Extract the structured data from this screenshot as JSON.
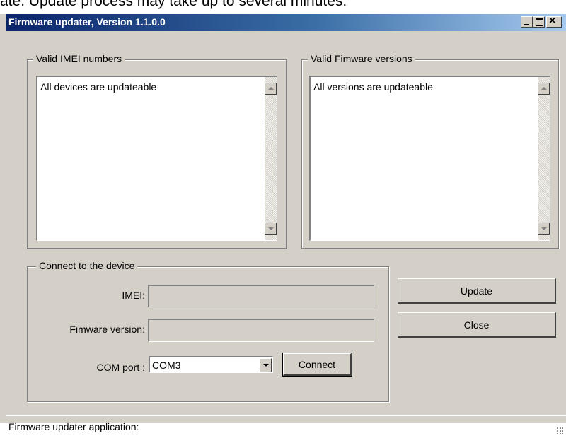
{
  "background_doc": {
    "text": "ate. Update process may take up to several minutes."
  },
  "window": {
    "title": "Firmware updater, Version 1.1.0.0",
    "controls": {
      "minimize_icon": "minimize-icon",
      "maximize_icon": "maximize-icon",
      "close_icon": "close-icon"
    }
  },
  "imei_group": {
    "legend": "Valid IMEI numbers",
    "items": [
      "All devices are updateable"
    ]
  },
  "firmware_group": {
    "legend": "Valid Fimware versions",
    "items": [
      "All versions are updateable"
    ]
  },
  "connect_group": {
    "legend": "Connect to the device",
    "imei_label": "IMEI:",
    "imei_value": "",
    "firmware_label": "Fimware version:",
    "firmware_value": "",
    "com_label": "COM port :",
    "com_value": "COM3",
    "connect_button": "Connect"
  },
  "buttons": {
    "update": "Update",
    "close": "Close"
  },
  "status": {
    "text": "Firmware updater application:"
  },
  "colors": {
    "face": "#d4d0c8",
    "title_start": "#0a246a",
    "title_end": "#a6caf0"
  }
}
